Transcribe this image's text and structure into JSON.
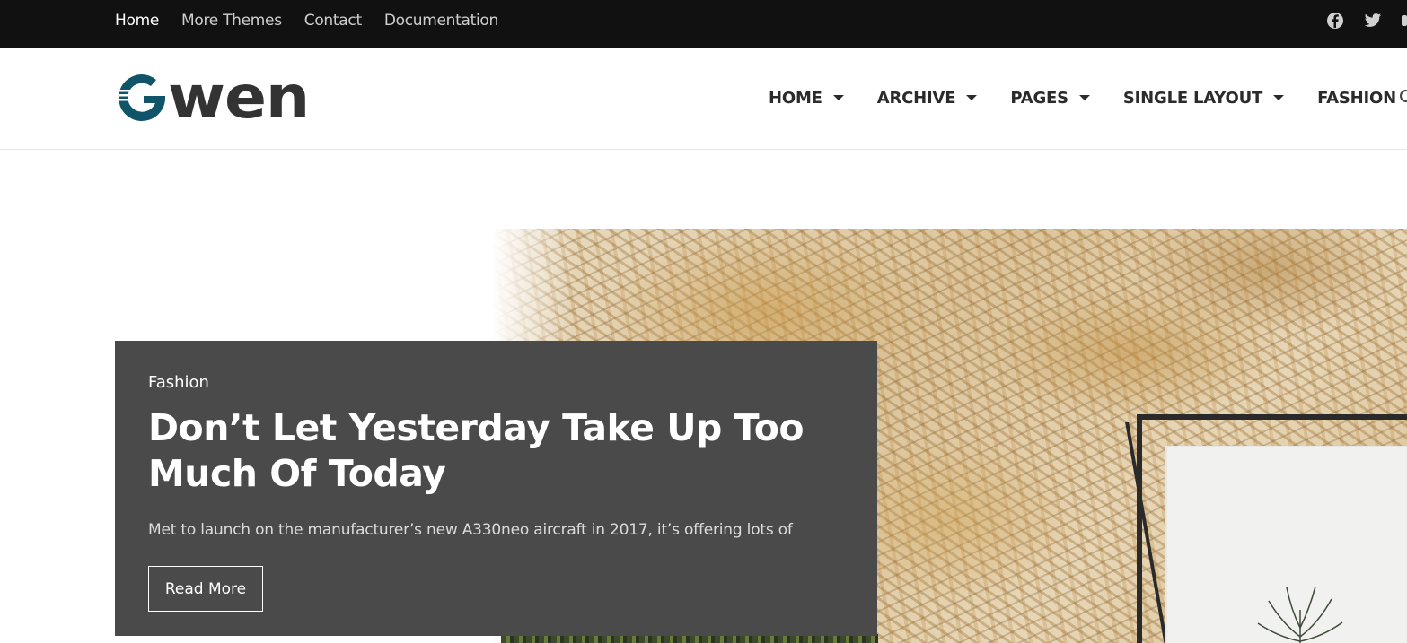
{
  "topbar": {
    "links": [
      {
        "label": "Home",
        "active": true
      },
      {
        "label": "More Themes",
        "active": false
      },
      {
        "label": "Contact",
        "active": false
      },
      {
        "label": "Documentation",
        "active": false
      }
    ],
    "social_icons": [
      "facebook-icon",
      "twitter-icon"
    ],
    "background": "#111111"
  },
  "header": {
    "logo_text": "wen",
    "brand_color": "#0f5468",
    "nav": [
      {
        "label": "HOME",
        "has_dropdown": true
      },
      {
        "label": "ARCHIVE",
        "has_dropdown": true
      },
      {
        "label": "PAGES",
        "has_dropdown": true
      },
      {
        "label": "SINGLE LAYOUT",
        "has_dropdown": true
      },
      {
        "label": "FASHION",
        "has_dropdown": false
      }
    ]
  },
  "hero": {
    "category": "Fashion",
    "title": "Don’t Let Yesterday Take Up Too Much Of Today",
    "excerpt": "Met to launch on the manufacturer’s new A330neo aircraft in 2017, it’s offering lots of",
    "read_more_label": "Read More",
    "card_color": "#4a4a4a"
  }
}
